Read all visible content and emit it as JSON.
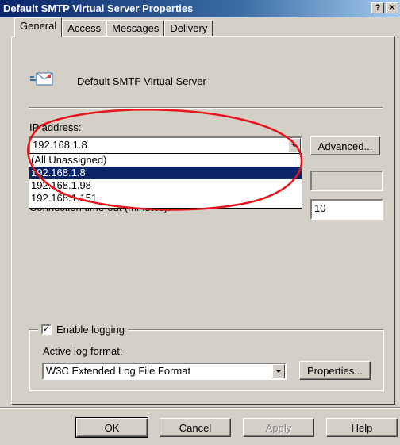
{
  "window": {
    "title": "Default SMTP Virtual Server Properties",
    "help_button": "?",
    "close_button": "✕"
  },
  "tabs": [
    {
      "label": "General",
      "active": true
    },
    {
      "label": "Access",
      "active": false
    },
    {
      "label": "Messages",
      "active": false
    },
    {
      "label": "Delivery",
      "active": false
    }
  ],
  "general": {
    "server_name": "Default SMTP Virtual Server",
    "ip_address_label": "IP address:",
    "ip_address_value": "192.168.1.8",
    "ip_options": [
      "(All Unassigned)",
      "192.168.1.8",
      "192.168.1.98",
      "192.168.1.151"
    ],
    "selected_option_index": 1,
    "advanced_button": "Advanced...",
    "connection_timeout_label": "Connection time-out (minutes):",
    "connection_timeout_value": "10",
    "logging": {
      "enable_logging_label": "Enable logging",
      "enabled": true,
      "active_log_format_label": "Active log format:",
      "log_format_value": "W3C Extended Log File Format",
      "properties_button": "Properties..."
    }
  },
  "footer": {
    "ok": "OK",
    "cancel": "Cancel",
    "apply": "Apply",
    "help": "Help"
  },
  "annotation": {
    "color": "#e8141c"
  }
}
